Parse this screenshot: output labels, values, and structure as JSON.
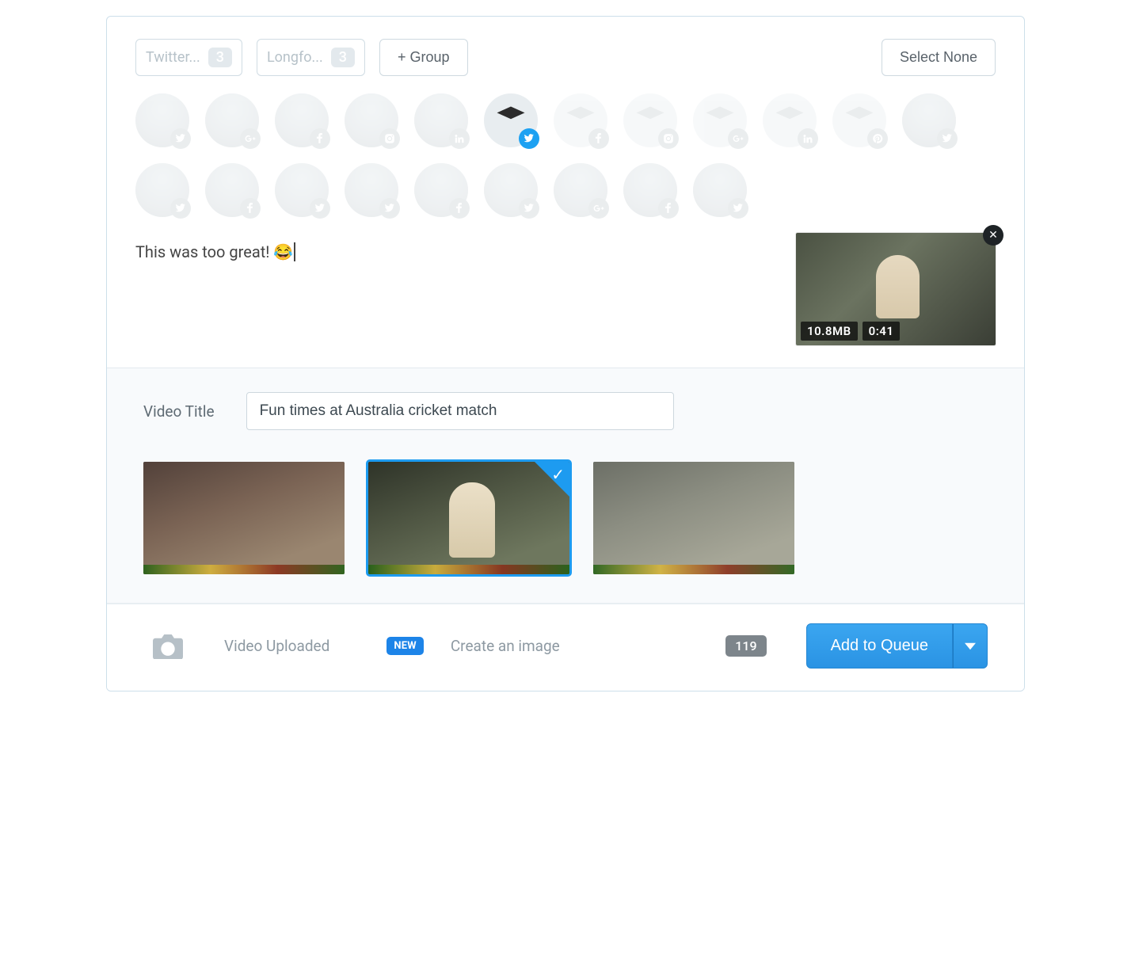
{
  "groups": [
    {
      "label": "Twitter...",
      "count": "3"
    },
    {
      "label": "Longfo...",
      "count": "3"
    }
  ],
  "add_group_label": "+ Group",
  "select_none_label": "Select None",
  "avatars": [
    {
      "network": "twitter",
      "type": "user"
    },
    {
      "network": "googleplus",
      "type": "user"
    },
    {
      "network": "facebook",
      "type": "user"
    },
    {
      "network": "instagram",
      "type": "user"
    },
    {
      "network": "linkedin",
      "type": "user"
    },
    {
      "network": "twitter",
      "type": "buffer",
      "selected": true
    },
    {
      "network": "facebook",
      "type": "buffer"
    },
    {
      "network": "instagram",
      "type": "buffer"
    },
    {
      "network": "googleplus",
      "type": "buffer"
    },
    {
      "network": "linkedin",
      "type": "buffer"
    },
    {
      "network": "pinterest",
      "type": "buffer"
    },
    {
      "network": "twitter",
      "type": "user"
    },
    {
      "network": "twitter",
      "type": "user"
    },
    {
      "network": "facebook",
      "type": "user"
    },
    {
      "network": "twitter",
      "type": "user"
    },
    {
      "network": "twitter",
      "type": "user"
    },
    {
      "network": "facebook",
      "type": "user"
    },
    {
      "network": "twitter",
      "type": "user"
    },
    {
      "network": "googleplus",
      "type": "user"
    },
    {
      "network": "facebook",
      "type": "user"
    },
    {
      "network": "twitter",
      "type": "user"
    }
  ],
  "compose": {
    "text": "This was too great! 😂"
  },
  "video_preview": {
    "size": "10.8MB",
    "duration": "0:41"
  },
  "video_title": {
    "label": "Video Title",
    "value": "Fun times at Australia cricket match"
  },
  "thumbnails": {
    "selected_index": 1
  },
  "footer": {
    "uploaded_label": "Video Uploaded",
    "new_badge": "NEW",
    "create_image_label": "Create an image",
    "char_count": "119",
    "queue_label": "Add to Queue"
  }
}
